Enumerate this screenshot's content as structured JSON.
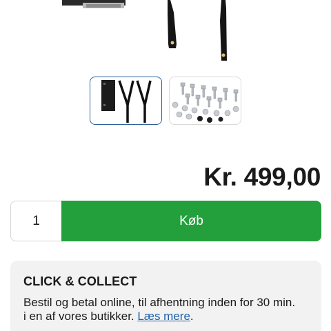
{
  "product": {
    "main_image_icon": "product-image-icon",
    "thumbnails": [
      {
        "icon": "bracket-straps-thumbnail-icon",
        "selected": true
      },
      {
        "icon": "bolts-nuts-thumbnail-icon",
        "selected": false
      }
    ],
    "price": "Kr. 499,00"
  },
  "purchase": {
    "quantity": "1",
    "buy_label": "Køb"
  },
  "click_collect": {
    "title": "CLICK & COLLECT",
    "text": "Bestil og betal online, til afhentning inden for 30 min. i en af vores butikker.",
    "link_label": "Læs mere",
    "trailing": "."
  },
  "colors": {
    "buy_green": "#23a03c",
    "link_blue": "#1d5fa8",
    "selected_border": "#2f5f9a",
    "info_box_bg": "#f2f2f2"
  }
}
